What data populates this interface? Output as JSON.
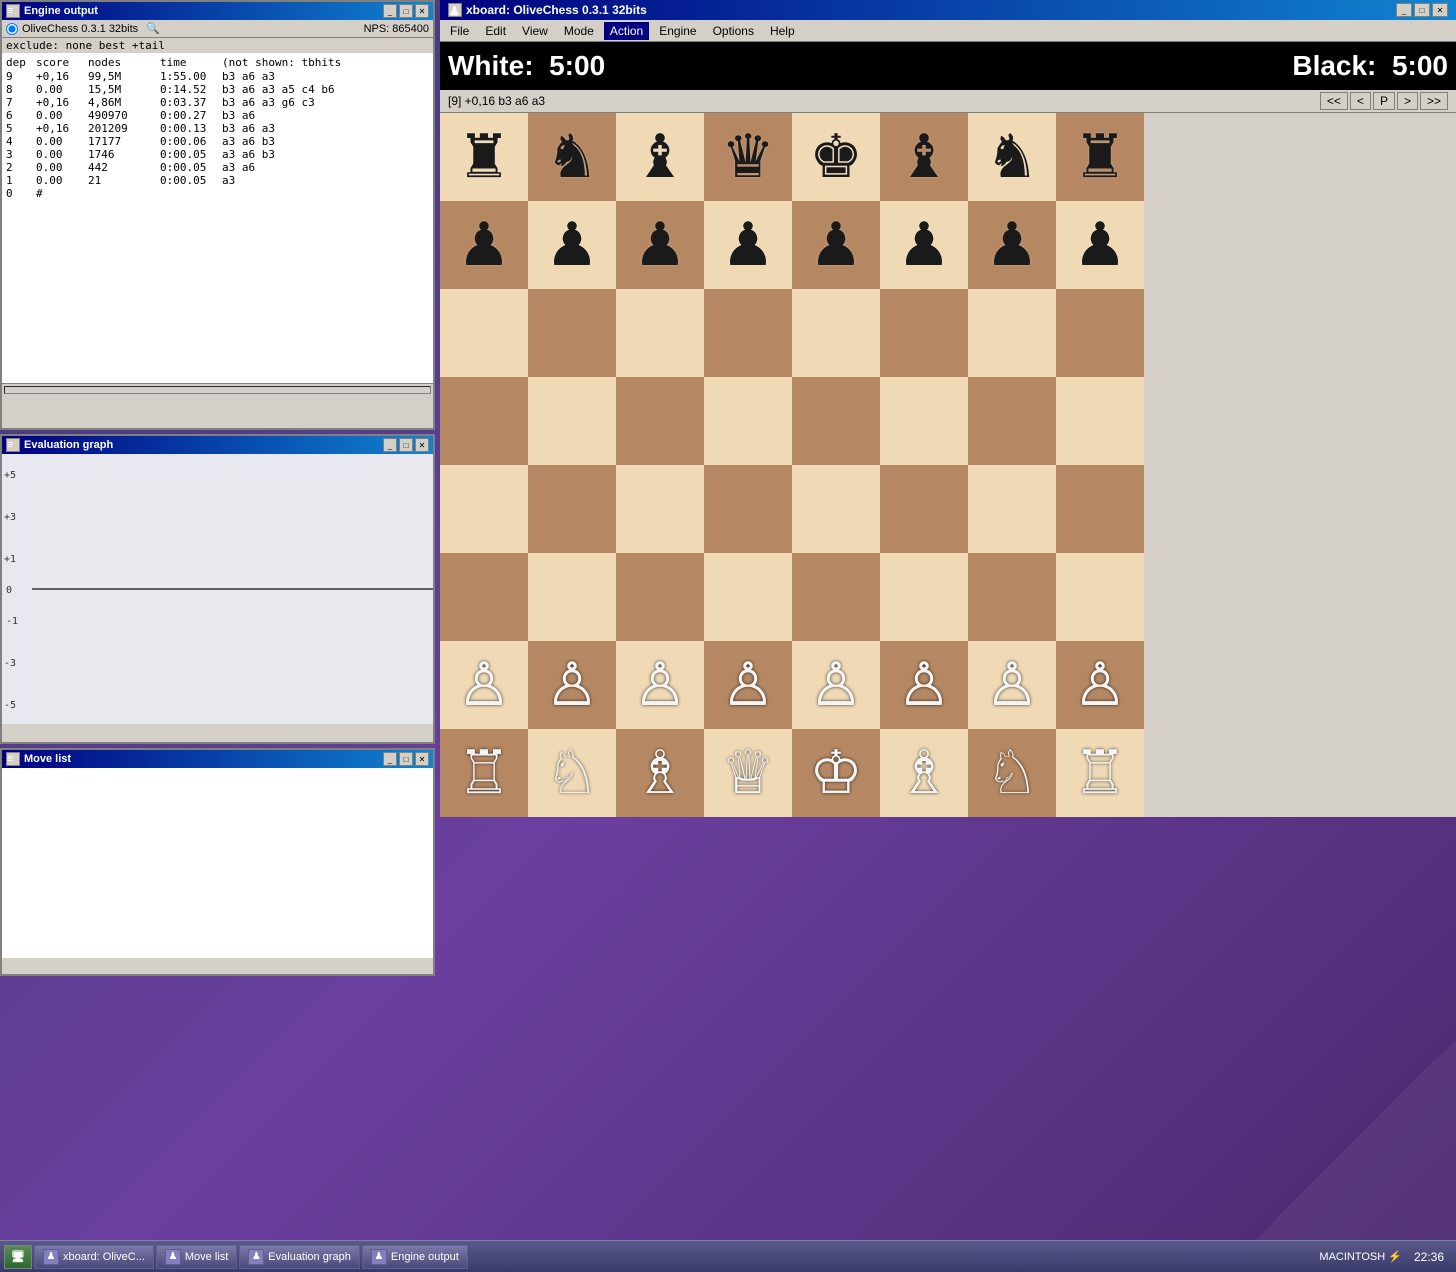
{
  "engine_output": {
    "title": "Engine output",
    "engine_name": "OliveChess 0.3.1 32bits",
    "nps": "NPS: 865400",
    "exclude_line": "exclude: none  best +tail",
    "columns": {
      "dep": "dep",
      "score": "score",
      "nodes": "nodes",
      "time": "time",
      "extra": "(not shown: tbhits"
    },
    "rows": [
      {
        "dep": "9",
        "score": "+0,16",
        "nodes": "99,5M",
        "time": "1:55.00",
        "moves": "b3 a6 a3"
      },
      {
        "dep": "8",
        "score": "0.00",
        "nodes": "15,5M",
        "time": "0:14.52",
        "moves": "b3 a6 a3 a5 c4 b6"
      },
      {
        "dep": "7",
        "score": "+0,16",
        "nodes": "4,86M",
        "time": "0:03.37",
        "moves": "b3 a6 a3 g6 c3"
      },
      {
        "dep": "6",
        "score": "0.00",
        "nodes": "490970",
        "time": "0:00.27",
        "moves": "b3 a6"
      },
      {
        "dep": "5",
        "score": "+0,16",
        "nodes": "201209",
        "time": "0:00.13",
        "moves": "b3 a6 a3"
      },
      {
        "dep": "4",
        "score": "0.00",
        "nodes": "17177",
        "time": "0:00.06",
        "moves": "a3 a6 b3"
      },
      {
        "dep": "3",
        "score": "0.00",
        "nodes": "1746",
        "time": "0:00.05",
        "moves": "a3 a6 b3"
      },
      {
        "dep": "2",
        "score": "0.00",
        "nodes": "442",
        "time": "0:00.05",
        "moves": "a3 a6"
      },
      {
        "dep": "1",
        "score": "0.00",
        "nodes": "21",
        "time": "0:00.05",
        "moves": "a3"
      },
      {
        "dep": "0",
        "score": "#",
        "nodes": "",
        "time": "",
        "moves": ""
      }
    ]
  },
  "eval_graph": {
    "title": "Evaluation graph",
    "labels": [
      "+5",
      "+3",
      "+1",
      "0",
      "-1",
      "-3",
      "-5"
    ]
  },
  "move_list": {
    "title": "Move list"
  },
  "xboard": {
    "title": "xboard: OliveChess 0.3.1 32bits",
    "menu": {
      "file": "File",
      "edit": "Edit",
      "view": "View",
      "mode": "Mode",
      "action": "Action",
      "engine": "Engine",
      "options": "Options",
      "help": "Help"
    },
    "status_line": "[9] +0,16 b3 a6 a3",
    "nav_buttons": [
      "<<",
      "<",
      "P",
      ">",
      ">>"
    ],
    "clock_white_label": "White:",
    "clock_white_time": "5:00",
    "clock_black_label": "Black:",
    "clock_black_time": "5:00"
  },
  "board": {
    "pieces": [
      [
        "br",
        "bn",
        "bb",
        "bq",
        "bk",
        "bb",
        "bn",
        "br"
      ],
      [
        "bp",
        "bp",
        "bp",
        "bp",
        "bp",
        "bp",
        "bp",
        "bp"
      ],
      [
        "",
        "",
        "",
        "",
        "",
        "",
        "",
        ""
      ],
      [
        "",
        "",
        "",
        "",
        "",
        "",
        "",
        ""
      ],
      [
        "",
        "",
        "",
        "",
        "",
        "",
        "",
        ""
      ],
      [
        "",
        "",
        "",
        "",
        "",
        "",
        "",
        ""
      ],
      [
        "wp",
        "wp",
        "wp",
        "wp",
        "wp",
        "wp",
        "wp",
        "wp"
      ],
      [
        "wr",
        "wn",
        "wb",
        "wq",
        "wk",
        "wb",
        "wn",
        "wr"
      ]
    ]
  },
  "taskbar": {
    "start_label": "▶",
    "items": [
      {
        "icon": "♟",
        "label": "xboard: OliveC..."
      },
      {
        "icon": "♟",
        "label": "Move list"
      },
      {
        "icon": "♟",
        "label": "Evaluation graph"
      },
      {
        "icon": "♟",
        "label": "Engine output"
      }
    ],
    "tray_label": "MACINTOSH ⚡",
    "clock": "22:36"
  }
}
